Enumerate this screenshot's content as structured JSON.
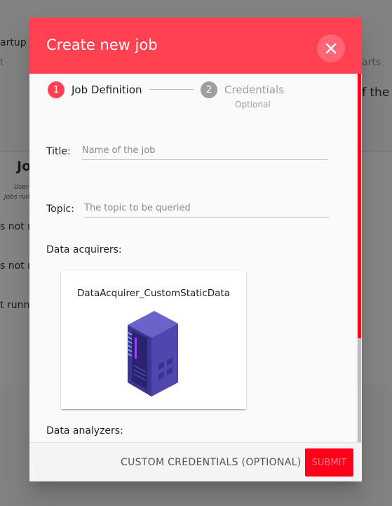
{
  "background": {
    "fragments": [
      "artup",
      "t",
      "arts",
      "f the p",
      "Jo",
      "User",
      "Jobs run",
      "s not r",
      "s not ru",
      "t runni"
    ]
  },
  "dialog": {
    "title": "Create new job",
    "close_icon": "close-icon",
    "stepper": {
      "steps": [
        {
          "number": "1",
          "label": "Job Definition",
          "state": "active"
        },
        {
          "number": "2",
          "label": "Credentials",
          "sublabel": "Optional",
          "state": "inactive"
        }
      ]
    },
    "form": {
      "title_label": "Title:",
      "title_placeholder": "Name of the job",
      "topic_label": "Topic:",
      "topic_placeholder": "The topic to be queried",
      "data_acquirers_label": "Data acquirers:",
      "acquirer_cards": [
        {
          "name": "DataAcquirer_CustomStaticData",
          "icon": "server-icon"
        }
      ],
      "data_analyzers_label": "Data analyzers:"
    },
    "footer": {
      "custom_credentials_label": "CUSTOM CREDENTIALS (OPTIONAL)",
      "submit_label": "SUBMIT"
    }
  },
  "colors": {
    "header": "#ff4050",
    "accent": "#ff0018",
    "step_inactive": "#9e9e9e"
  }
}
